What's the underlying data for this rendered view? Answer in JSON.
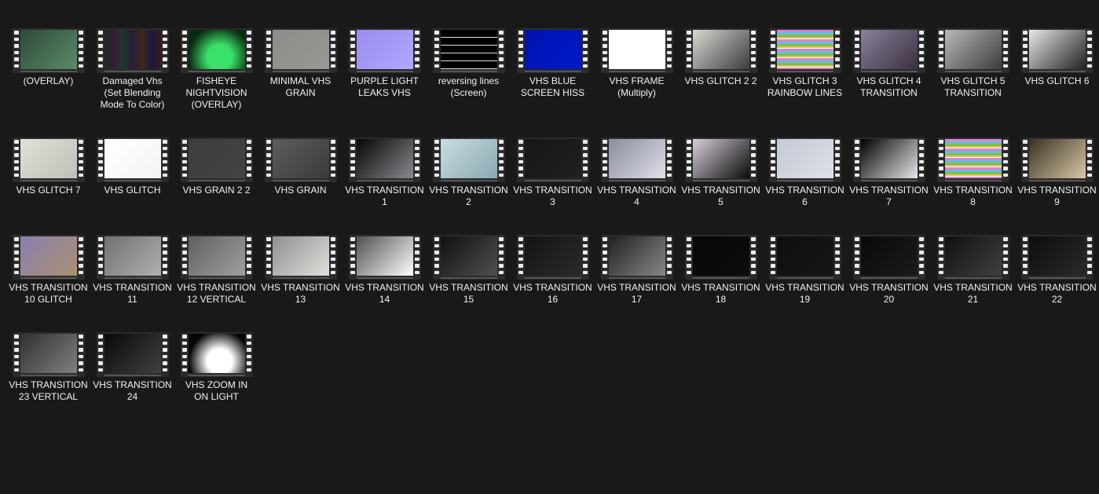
{
  "files": [
    {
      "name": "(OVERLAY)",
      "colors": [
        "#2f4a3a",
        "#5a8a6a"
      ]
    },
    {
      "name": "Damaged Vhs\n(Set Blending\nMode To Color)",
      "colors": [
        "#2a1a2e",
        "#1e2e1e"
      ],
      "stripes": true
    },
    {
      "name": "FISHEYE\nNIGHTVISION\n(OVERLAY)",
      "colors": [
        "#3be06a",
        "#0a2a10"
      ],
      "radial": true
    },
    {
      "name": "MINIMAL VHS\nGRAIN",
      "colors": [
        "#8e8c88",
        "#9a9894"
      ]
    },
    {
      "name": "PURPLE LIGHT\nLEAKS VHS",
      "colors": [
        "#9a8cf0",
        "#b0a8ff"
      ]
    },
    {
      "name": "reversing lines\n(Screen)",
      "colors": [
        "#000000",
        "#111111"
      ],
      "lines": true
    },
    {
      "name": "VHS BLUE\nSCREEN HISS",
      "colors": [
        "#0012b0",
        "#0018c8"
      ]
    },
    {
      "name": "VHS FRAME\n(Multiply)",
      "colors": [
        "#ffffff",
        "#ffffff"
      ]
    },
    {
      "name": "VHS GLITCH 2   2",
      "colors": [
        "#d8d8d0",
        "#3a3c40"
      ]
    },
    {
      "name": "VHS GLITCH 3\nRAINBOW LINES",
      "colors": [
        "#d07ad0",
        "#4ac060"
      ],
      "rainbow": true
    },
    {
      "name": "VHS GLITCH 4\nTRANSITION",
      "colors": [
        "#8a8098",
        "#3a3040"
      ]
    },
    {
      "name": "VHS GLITCH 5\nTRANSITION",
      "colors": [
        "#b8b8b8",
        "#3c3c3c"
      ]
    },
    {
      "name": "VHS GLITCH 6",
      "colors": [
        "#e8e8e8",
        "#202020"
      ]
    },
    {
      "name": "VHS GLITCH 7",
      "colors": [
        "#e0e0d8",
        "#c0c0b8"
      ]
    },
    {
      "name": "VHS GLITCH",
      "colors": [
        "#ffffff",
        "#f4f4f4"
      ]
    },
    {
      "name": "VHS GRAIN 2    2",
      "colors": [
        "#3c3c3c",
        "#444444"
      ]
    },
    {
      "name": "VHS GRAIN",
      "colors": [
        "#5c5c5c",
        "#3a3a3a"
      ]
    },
    {
      "name": "VHS TRANSITION\n1",
      "colors": [
        "#050505",
        "#8a8a90"
      ]
    },
    {
      "name": "VHS TRANSITION\n2",
      "colors": [
        "#c8dde4",
        "#8aa8b0"
      ]
    },
    {
      "name": "VHS TRANSITION\n3",
      "colors": [
        "#161616",
        "#202020"
      ]
    },
    {
      "name": "VHS TRANSITION\n4",
      "colors": [
        "#8a8c9c",
        "#e0e0ea"
      ]
    },
    {
      "name": "VHS TRANSITION\n5",
      "colors": [
        "#d8d0dc",
        "#0a0a0a"
      ]
    },
    {
      "name": "VHS TRANSITION\n6",
      "colors": [
        "#c4cad4",
        "#dde0e8"
      ]
    },
    {
      "name": "VHS TRANSITION\n7",
      "colors": [
        "#000000",
        "#e8e8ec"
      ]
    },
    {
      "name": "VHS TRANSITION\n8",
      "colors": [
        "#a060c0",
        "#40a060"
      ],
      "rainbow": true
    },
    {
      "name": "VHS TRANSITION\n9",
      "colors": [
        "#3a3020",
        "#d8c8a8"
      ]
    },
    {
      "name": "VHS TRANSITION\n10 GLITCH",
      "colors": [
        "#8a80b0",
        "#a89070"
      ]
    },
    {
      "name": "VHS TRANSITION\n11",
      "colors": [
        "#707070",
        "#b0b0b0"
      ]
    },
    {
      "name": "VHS TRANSITION\n12 VERTICAL",
      "colors": [
        "#606060",
        "#a0a0a0"
      ]
    },
    {
      "name": "VHS TRANSITION\n13",
      "colors": [
        "#909090",
        "#e0e0dc"
      ]
    },
    {
      "name": "VHS TRANSITION\n14",
      "colors": [
        "#505050",
        "#ffffff"
      ]
    },
    {
      "name": "VHS TRANSITION\n15",
      "colors": [
        "#101010",
        "#505050"
      ]
    },
    {
      "name": "VHS TRANSITION\n16",
      "colors": [
        "#141414",
        "#2a2a28"
      ]
    },
    {
      "name": "VHS TRANSITION\n17",
      "colors": [
        "#202020",
        "#888888"
      ]
    },
    {
      "name": "VHS TRANSITION\n18",
      "colors": [
        "#080808",
        "#0c0c0c"
      ]
    },
    {
      "name": "VHS TRANSITION\n19",
      "colors": [
        "#0e0e0e",
        "#161616"
      ]
    },
    {
      "name": "VHS TRANSITION\n20",
      "colors": [
        "#0a0a0a",
        "#1a1a1a"
      ]
    },
    {
      "name": "VHS TRANSITION\n21",
      "colors": [
        "#101010",
        "#404040"
      ]
    },
    {
      "name": "VHS TRANSITION\n22",
      "colors": [
        "#0c0c0c",
        "#2a2a2a"
      ]
    },
    {
      "name": "VHS TRANSITION\n23 VERTICAL",
      "colors": [
        "#303030",
        "#808080"
      ]
    },
    {
      "name": "VHS TRANSITION\n24",
      "colors": [
        "#080808",
        "#404040"
      ]
    },
    {
      "name": "VHS ZOOM IN\nON LIGHT",
      "colors": [
        "#ffffff",
        "#050505"
      ],
      "radial": true
    }
  ]
}
